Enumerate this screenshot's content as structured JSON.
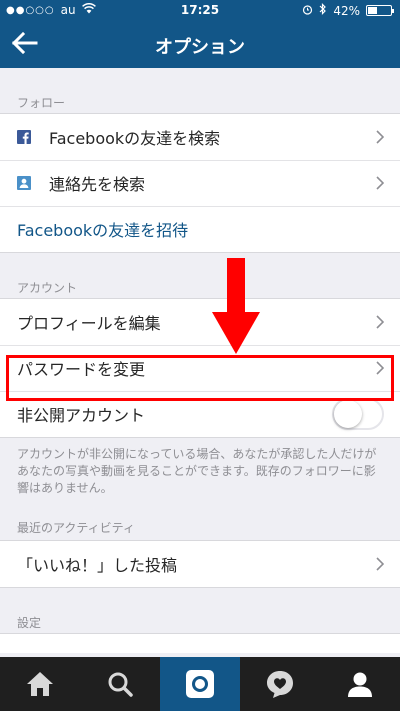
{
  "status_bar": {
    "signal": "●●○○○",
    "carrier": "au",
    "time": "17:25",
    "battery": "42%",
    "battery_level": 0.42
  },
  "nav": {
    "title": "オプション",
    "back_icon": "arrow-left-icon"
  },
  "sections": {
    "follow": {
      "header": "フォロー",
      "items": [
        {
          "label": "Facebookの友達を検索",
          "icon": "facebook-icon"
        },
        {
          "label": "連絡先を検索",
          "icon": "contacts-icon"
        },
        {
          "label": "Facebookの友達を招待"
        }
      ]
    },
    "account": {
      "header": "アカウント",
      "items": [
        {
          "label": "プロフィールを編集"
        },
        {
          "label": "パスワードを変更"
        },
        {
          "label": "非公開アカウント",
          "toggle_on": false
        }
      ],
      "note": "アカウントが非公開になっている場合、あなたが承認した人だけがあなたの写真や動画を見ることができます。既存のフォロワーに影響はありません。"
    },
    "activity": {
      "header": "最近のアクティビティ",
      "items": [
        {
          "label": "「いいね！」した投稿"
        }
      ]
    },
    "settings": {
      "header": "設定"
    }
  },
  "tabbar": {
    "items": [
      "home-icon",
      "search-icon",
      "camera-icon",
      "activity-heart-icon",
      "profile-icon"
    ],
    "active_index": 2
  },
  "colors": {
    "brand": "#125688",
    "highlight": "#ff0000",
    "background": "#efeff4",
    "tabbar": "#1f1f1f"
  }
}
